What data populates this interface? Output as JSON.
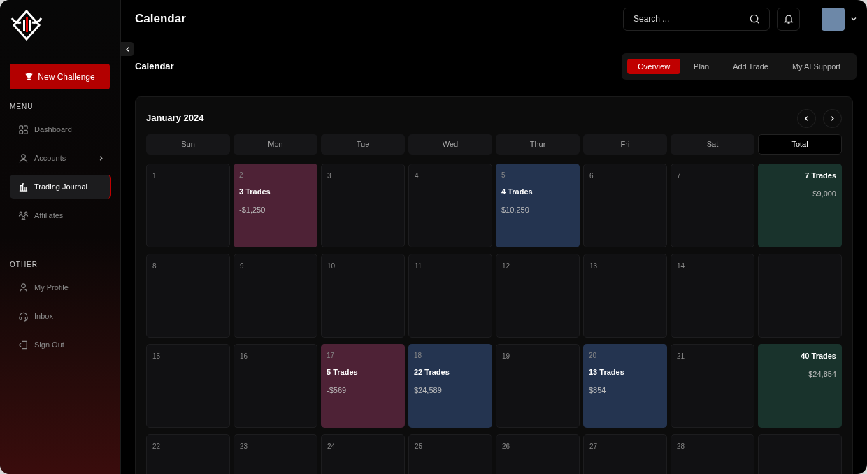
{
  "sidebar": {
    "new_challenge": "New Challenge",
    "sections": [
      {
        "heading": "MENU",
        "items": [
          {
            "label": "Dashboard",
            "kind": "grid",
            "selected": false,
            "expandable": false
          },
          {
            "label": "Accounts",
            "kind": "user",
            "selected": false,
            "expandable": true
          },
          {
            "label": "Trading Journal",
            "kind": "chart",
            "selected": true,
            "expandable": false
          },
          {
            "label": "Affiliates",
            "kind": "people",
            "selected": false,
            "expandable": false
          }
        ]
      },
      {
        "heading": "OTHER",
        "items": [
          {
            "label": "My Profile",
            "kind": "user",
            "selected": false,
            "expandable": false
          },
          {
            "label": "Inbox",
            "kind": "headset",
            "selected": false,
            "expandable": false
          },
          {
            "label": "Sign Out",
            "kind": "logout",
            "selected": false,
            "expandable": false
          }
        ]
      }
    ]
  },
  "header": {
    "title": "Calendar",
    "search": {
      "placeholder": "Search ..."
    }
  },
  "page": {
    "title": "Calendar",
    "tabs": [
      {
        "label": "Overview",
        "selected": true
      },
      {
        "label": "Plan",
        "selected": false
      },
      {
        "label": "Add Trade",
        "selected": false
      },
      {
        "label": "My AI Support",
        "selected": false
      }
    ]
  },
  "calendar": {
    "month": "January 2024",
    "columns": [
      "Sun",
      "Mon",
      "Tue",
      "Wed",
      "Thur",
      "Fri",
      "Sat",
      "Total"
    ],
    "weeks": [
      [
        {
          "kind": "empty",
          "day": "1"
        },
        {
          "kind": "loss",
          "day": "2",
          "trades": "3 Trades",
          "amount": "-$1,250"
        },
        {
          "kind": "empty",
          "day": "3"
        },
        {
          "kind": "empty",
          "day": "4"
        },
        {
          "kind": "gain",
          "day": "5",
          "trades": "4 Trades",
          "amount": "$10,250"
        },
        {
          "kind": "empty",
          "day": "6"
        },
        {
          "kind": "empty",
          "day": "7"
        },
        {
          "kind": "total",
          "trades": "7 Trades",
          "amount": "$9,000"
        }
      ],
      [
        {
          "kind": "empty",
          "day": "8"
        },
        {
          "kind": "empty",
          "day": "9"
        },
        {
          "kind": "empty",
          "day": "10"
        },
        {
          "kind": "empty",
          "day": "11"
        },
        {
          "kind": "empty",
          "day": "12"
        },
        {
          "kind": "empty",
          "day": "13"
        },
        {
          "kind": "empty",
          "day": "14"
        },
        {
          "kind": "blank"
        }
      ],
      [
        {
          "kind": "empty",
          "day": "15"
        },
        {
          "kind": "empty",
          "day": "16"
        },
        {
          "kind": "loss",
          "day": "17",
          "trades": "5 Trades",
          "amount": "-$569"
        },
        {
          "kind": "gain",
          "day": "18",
          "trades": "22 Trades",
          "amount": "$24,589"
        },
        {
          "kind": "empty",
          "day": "19"
        },
        {
          "kind": "gain",
          "day": "20",
          "trades": "13 Trades",
          "amount": "$854"
        },
        {
          "kind": "empty",
          "day": "21"
        },
        {
          "kind": "total",
          "trades": "40 Trades",
          "amount": "$24,854"
        }
      ],
      [
        {
          "kind": "empty",
          "day": "22"
        },
        {
          "kind": "empty",
          "day": "23"
        },
        {
          "kind": "empty",
          "day": "24"
        },
        {
          "kind": "empty",
          "day": "25"
        },
        {
          "kind": "empty",
          "day": "26"
        },
        {
          "kind": "empty",
          "day": "27"
        },
        {
          "kind": "empty",
          "day": "28"
        },
        {
          "kind": "blank"
        }
      ]
    ]
  }
}
